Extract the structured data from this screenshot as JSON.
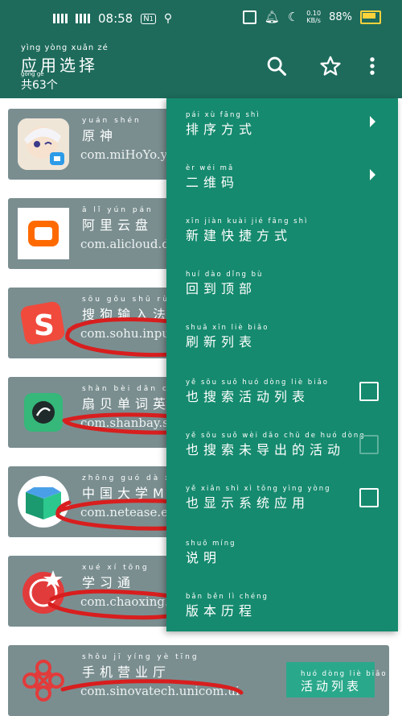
{
  "status_bar": {
    "time": "08:58",
    "net_speed_value": "0.10",
    "net_speed_unit": "KB/s",
    "battery_pct": "88%",
    "sim_badge": "1",
    "icons": [
      "signal-icon",
      "signal-icon",
      "nfc-icon",
      "usb-icon",
      "screenshot-icon",
      "notification-bell-icon",
      "moon-icon",
      "battery-icon"
    ]
  },
  "header": {
    "title_pinyin": "yìng yòng xuǎn zé",
    "title": "应用选择",
    "count_pinyin": "gòng gè",
    "count": "共63个",
    "actions": [
      "search-icon",
      "star-icon",
      "more-icon"
    ]
  },
  "apps": [
    {
      "pinyin": "yuán shén",
      "name": "原神",
      "package": "com.miHoYo.ys.",
      "icon": "genshin-icon"
    },
    {
      "pinyin": "ā lǐ yún pán",
      "name": "阿里云盘",
      "package": "com.alicloud.da",
      "icon": "aliyun-drive-icon"
    },
    {
      "pinyin": "sōu gǒu shū rù fǎ",
      "name": "搜狗输入法",
      "package": "com.sohu.input",
      "icon": "sogou-input-icon"
    },
    {
      "pinyin": "shàn bèi dān cí yīng",
      "name": "扇贝单词英",
      "package": "com.shanbay.se",
      "icon": "shanbay-icon"
    },
    {
      "pinyin": "zhōng guó dà xué",
      "name": "中国大学MO",
      "package": "com.netease.ed",
      "icon": "icourse-icon"
    },
    {
      "pinyin": "xué xí tōng",
      "name": "学习通",
      "package": "com.chaoxing.m",
      "icon": "chaoxing-icon"
    },
    {
      "pinyin": "shǒu jī yíng yè tīng",
      "name": "手机营业厅",
      "package": "com.sinovatech.unicom.ui",
      "icon": "unicom-icon"
    }
  ],
  "menu": {
    "items": [
      {
        "pinyin": "pái xù fāng shì",
        "label": "排序方式",
        "type": "submenu"
      },
      {
        "pinyin": "èr wéi mǎ",
        "label": "二维码",
        "type": "submenu"
      },
      {
        "pinyin": "xīn jiàn kuài jié fāng shì",
        "label": "新建快捷方式",
        "type": "action"
      },
      {
        "pinyin": "huí dào dǐng bù",
        "label": "回到顶部",
        "type": "action"
      },
      {
        "pinyin": "shuā xīn liè biǎo",
        "label": "刷新列表",
        "type": "action"
      },
      {
        "pinyin": "yě sōu suǒ huó dòng liè biǎo",
        "label": "也搜索活动列表",
        "type": "checkbox",
        "checked": false
      },
      {
        "pinyin": "yě sōu suǒ wèi dǎo chū de huó dòng",
        "label": "也搜索未导出的活动",
        "type": "checkbox",
        "checked": false,
        "disabled": true
      },
      {
        "pinyin": "yě xiǎn shì xì tǒng yìng yòng",
        "label": "也显示系统应用",
        "type": "checkbox",
        "checked": false
      },
      {
        "pinyin": "shuō míng",
        "label": "说明",
        "type": "action"
      },
      {
        "pinyin": "bǎn běn lì chéng",
        "label": "版本历程",
        "type": "action"
      }
    ]
  },
  "activity_button": {
    "pinyin": "huó dòng liè biǎo",
    "label": "活动列表"
  },
  "colors": {
    "primary": "#1e6b5c",
    "menu": "#158a6e",
    "card": "#7a8e90",
    "scribble": "#d42020"
  }
}
